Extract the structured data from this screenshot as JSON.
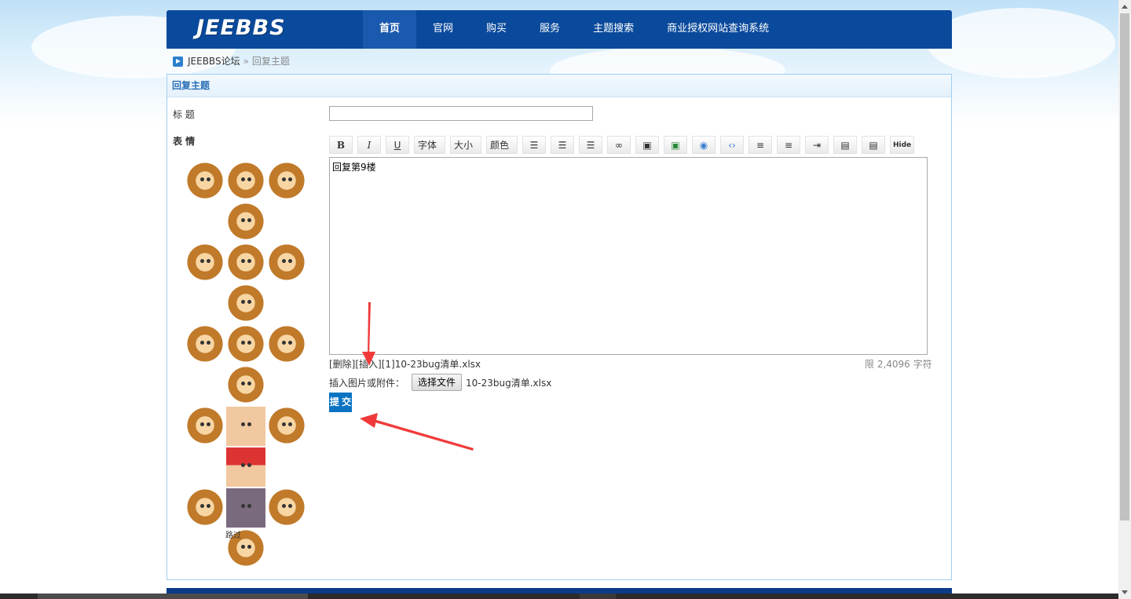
{
  "header": {
    "logo": "JEEBBS",
    "nav": [
      {
        "label": "首页",
        "active": true
      },
      {
        "label": "官网"
      },
      {
        "label": "购买"
      },
      {
        "label": "服务"
      },
      {
        "label": "主题搜索"
      },
      {
        "label": "商业授权网站查询系统"
      }
    ]
  },
  "breadcrumb": {
    "home": "JEEBBS论坛",
    "separator": "»",
    "current": "回复主题"
  },
  "panel": {
    "title": "回复主题",
    "title_label": "标 题",
    "title_value": "",
    "emoji_label": "表 情",
    "smiley_caption": "路过"
  },
  "toolbar": {
    "bold": "B",
    "italic": "I",
    "underline": "U",
    "font": "字体",
    "size": "大小",
    "color": "颜色",
    "hide": "Hide"
  },
  "editor": {
    "content": "回复第9楼",
    "attachment_line": "[删除][插入][1]10-23bug清单.xlsx",
    "limit": "限 2,4096 字符",
    "upload_label": "插入图片或附件：",
    "file_button": "选择文件",
    "file_name": "10-23bug清单.xlsx",
    "submit": "提 交"
  },
  "colors": {
    "header_bg": "#0a4a9c",
    "accent": "#0a74c2",
    "panel_border": "#9fcfee",
    "annotation_arrow": "#f03a3a"
  }
}
